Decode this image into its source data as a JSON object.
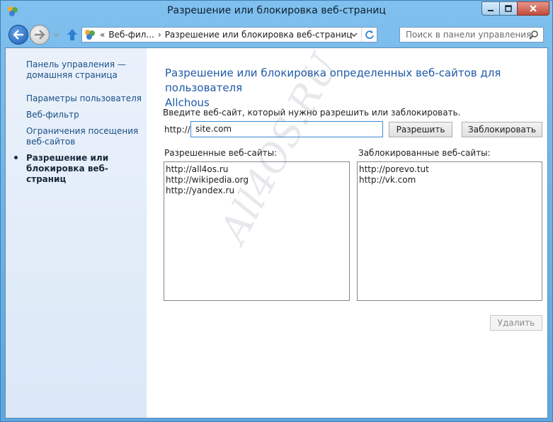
{
  "window": {
    "title": "Разрешение или блокировка веб-страниц"
  },
  "navigation": {
    "breadcrumbs": [
      "Веб-фил...",
      "Разрешение или блокировка веб-страниц"
    ],
    "search_placeholder": "Поиск в панели управления"
  },
  "sidebar": {
    "items": [
      {
        "label": "Панель управления —",
        "label2": "домашняя страница"
      },
      {
        "label": "Параметры пользователя"
      },
      {
        "label": "Веб-фильтр"
      },
      {
        "label": "Ограничения посещения",
        "label2": "веб-сайтов"
      },
      {
        "label": "Разрешение или",
        "label2": "блокировка веб-страниц",
        "current": true
      }
    ]
  },
  "main": {
    "heading_line1": "Разрешение или блокировка определенных веб-сайтов для пользователя",
    "heading_line2": "Allchous",
    "instruction": "Введите веб-сайт, который нужно разрешить или заблокировать.",
    "url_prefix": "http://",
    "site_input_value": "site.com",
    "allow_button": "Разрешить",
    "block_button": "Заблокировать",
    "allowed_label": "Разрешенные веб-сайты:",
    "blocked_label": "Заблокированные веб-сайты:",
    "allowed_sites": [
      "http://all4os.ru",
      "http://wikipedia.org",
      "http://yandex.ru"
    ],
    "blocked_sites": [
      "http://porevo.tut",
      "http://vk.com"
    ],
    "delete_button": "Удалить"
  },
  "watermark": "All4OS.RU",
  "colors": {
    "heading": "#1f5aa8",
    "link": "#1a4f86",
    "frame": "#6bb0e6",
    "input_focus": "#3a8ad3"
  }
}
